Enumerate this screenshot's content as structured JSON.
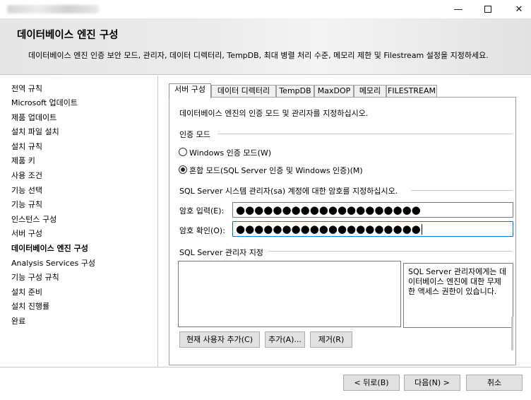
{
  "window": {
    "minimize_glyph": "—",
    "close_glyph": "✕"
  },
  "header": {
    "title": "데이터베이스 엔진 구성",
    "description": "데이터베이스 엔진 인증 보안 모드, 관리자, 데이터 디렉터리, TempDB, 최대 병렬 처리 수준, 메모리 제한 및 Filestream 설정을 지정하세요."
  },
  "sidebar": {
    "items": [
      {
        "label": "전역 규칙"
      },
      {
        "label": "Microsoft 업데이트"
      },
      {
        "label": "제품 업데이트"
      },
      {
        "label": "설치 파일 설치"
      },
      {
        "label": "설치 규칙"
      },
      {
        "label": "제품 키"
      },
      {
        "label": "사용 조건"
      },
      {
        "label": "기능 선택"
      },
      {
        "label": "기능 규칙"
      },
      {
        "label": "인스턴스 구성"
      },
      {
        "label": "서버 구성"
      },
      {
        "label": "데이터베이스 엔진 구성",
        "active": true
      },
      {
        "label": "Analysis Services 구성"
      },
      {
        "label": "기능 구성 규칙"
      },
      {
        "label": "설치 준비"
      },
      {
        "label": "설치 진행률"
      },
      {
        "label": "완료"
      }
    ]
  },
  "tabs": [
    {
      "label": "서버 구성",
      "active": true
    },
    {
      "label": "데이터 디렉터리"
    },
    {
      "label": "TempDB"
    },
    {
      "label": "MaxDOP"
    },
    {
      "label": "메모리"
    },
    {
      "label": "FILESTREAM"
    }
  ],
  "server_config": {
    "intro": "데이터베이스 엔진의 인증 모드 및 관리자를 지정하십시오.",
    "auth_group": "인증 모드",
    "auth_windows": "Windows 인증 모드(W)",
    "auth_mixed": "혼합 모드(SQL Server 인증 및 Windows 인증)(M)",
    "selected_auth": "mixed",
    "sa_prompt": "SQL Server 시스템 관리자(sa) 계정에 대한 암호를 지정하십시오.",
    "pwd_label": "암호 입력(E):",
    "pwd_value": "●●●●●●●●●●●●●●●●●●●●",
    "confirm_label": "암호 확인(O):",
    "confirm_value": "●●●●●●●●●●●●●●●●●●●●",
    "admin_group": "SQL Server 관리자 지정",
    "admin_info": "SQL Server 관리자에게는 데이터베이스 엔진에 대한 무제한 액세스 권한이 있습니다.",
    "add_current_user": "현재 사용자 추가(C)",
    "add": "추가(A)...",
    "remove": "제거(R)"
  },
  "footer": {
    "back": "< 뒤로(B)",
    "next": "다음(N) >",
    "cancel": "취소"
  }
}
